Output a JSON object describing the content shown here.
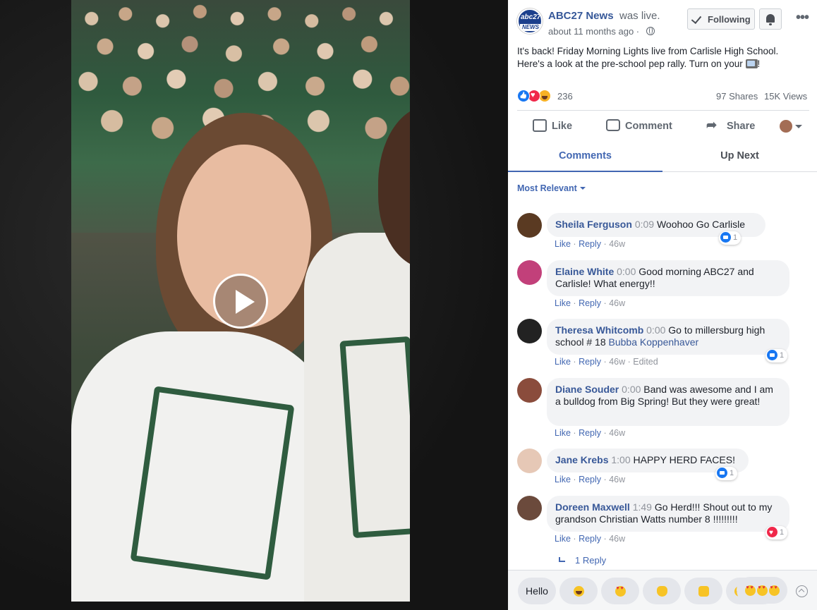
{
  "post": {
    "page_name": "ABC27 News",
    "was_live": "was live.",
    "timestamp": "about 11 months ago ·",
    "logo_text_top": "abc27",
    "logo_text_bottom": "NEWS",
    "following_label": "Following",
    "text": "It's back! Friday Morning Lights live from Carlisle High School. Here's a look at the pre-school pep rally. Turn on your ",
    "text_end": "!"
  },
  "stats": {
    "reactions": "236",
    "shares": "97 Shares",
    "views": "15K Views"
  },
  "actions": {
    "like": "Like",
    "comment": "Comment",
    "share": "Share"
  },
  "tabs": {
    "comments": "Comments",
    "up_next": "Up Next"
  },
  "sort_label": "Most Relevant",
  "comment_actions": {
    "like": "Like",
    "reply": "Reply",
    "separator": "·"
  },
  "comments": [
    {
      "name": "Sheila Ferguson",
      "time": "0:09",
      "text": "Woohoo Go Carlisle",
      "age": "46w",
      "reaction_count": "1",
      "avatar_color": "#5a3a22"
    },
    {
      "name": "Elaine White",
      "time": "0:00",
      "text": "Good morning ABC27 and Carlisle! What energy!!",
      "age": "46w",
      "avatar_color": "#c2407a"
    },
    {
      "name": "Theresa Whitcomb",
      "time": "0:00",
      "text": "Go to millersburg high school # 18 ",
      "mention": "Bubba Koppenhaver",
      "age": "46w",
      "edited": "Edited",
      "reaction_count": "1",
      "avatar_color": "#222222"
    },
    {
      "name": "Diane Souder",
      "time": "0:00",
      "text": "Band was awesome and I am a bulldog from Big Spring! But they were great!",
      "age": "46w",
      "avatar_color": "#8a4c3c"
    },
    {
      "name": "Jane Krebs",
      "time": "1:00",
      "text": "HAPPY HERD FACES!",
      "age": "46w",
      "reaction_count": "1",
      "avatar_color": "#e6c8b6"
    },
    {
      "name": "Doreen Maxwell",
      "time": "1:49",
      "text": "Go Herd!!! Shout out to my grandson Christian Watts number 8 !!!!!!!!!",
      "age": "46w",
      "reaction_count": "1",
      "avatar_color": "#6b4a3c"
    }
  ],
  "replies_link": "1 Reply",
  "quick_replies": {
    "hello": "Hello"
  },
  "colors": {
    "link_blue": "#385898",
    "accent_blue": "#4267b2",
    "like_blue": "#1877f2",
    "love_red": "#f0284a"
  }
}
